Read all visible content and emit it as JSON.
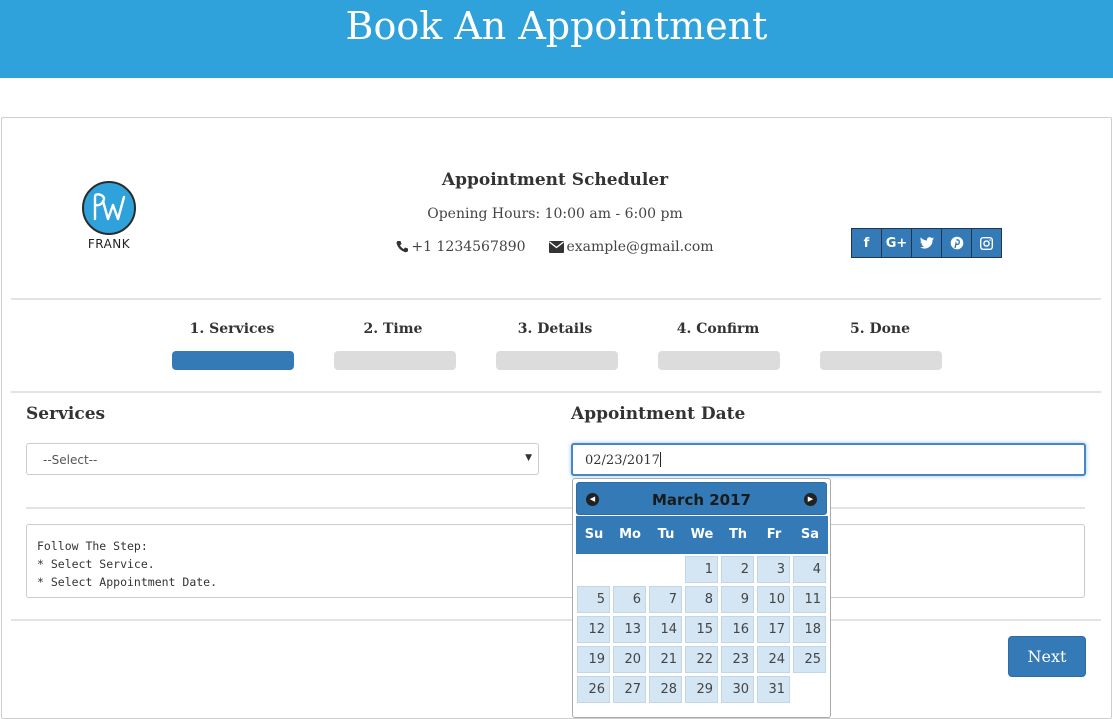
{
  "header": {
    "title": "Book An Appointment"
  },
  "brand": {
    "logo_text": "FRANK",
    "logo_mark": "PW"
  },
  "scheduler": {
    "title": "Appointment Scheduler",
    "hours": "Opening Hours: 10:00 am - 6:00 pm",
    "phone": "+1 1234567890",
    "email": "example@gmail.com"
  },
  "social": [
    {
      "name": "facebook-icon",
      "glyph": "f"
    },
    {
      "name": "google-plus-icon",
      "glyph": "G+"
    },
    {
      "name": "twitter-icon",
      "glyph": "t"
    },
    {
      "name": "pinterest-icon",
      "glyph": "p"
    },
    {
      "name": "instagram-icon",
      "glyph": "◎"
    }
  ],
  "steps": [
    {
      "label": "1. Services",
      "active": true
    },
    {
      "label": "2. Time",
      "active": false
    },
    {
      "label": "3. Details",
      "active": false
    },
    {
      "label": "4. Confirm",
      "active": false
    },
    {
      "label": "5. Done",
      "active": false
    }
  ],
  "form": {
    "services_label": "Services",
    "services_value": "--Select--",
    "date_label": "Appointment Date",
    "date_value": "02/23/2017"
  },
  "calendar": {
    "month_title": "March 2017",
    "weekdays": [
      "Su",
      "Mo",
      "Tu",
      "We",
      "Th",
      "Fr",
      "Sa"
    ],
    "first_weekday": 3,
    "days_in_month": 31
  },
  "info": {
    "lines": [
      "Follow The Step:",
      "* Select Service.",
      "* Select Appointment Date."
    ]
  },
  "actions": {
    "next_label": "Next"
  },
  "colors": {
    "banner": "#2fa1db",
    "primary": "#337ab7",
    "day_cell": "#d4e6f4"
  }
}
